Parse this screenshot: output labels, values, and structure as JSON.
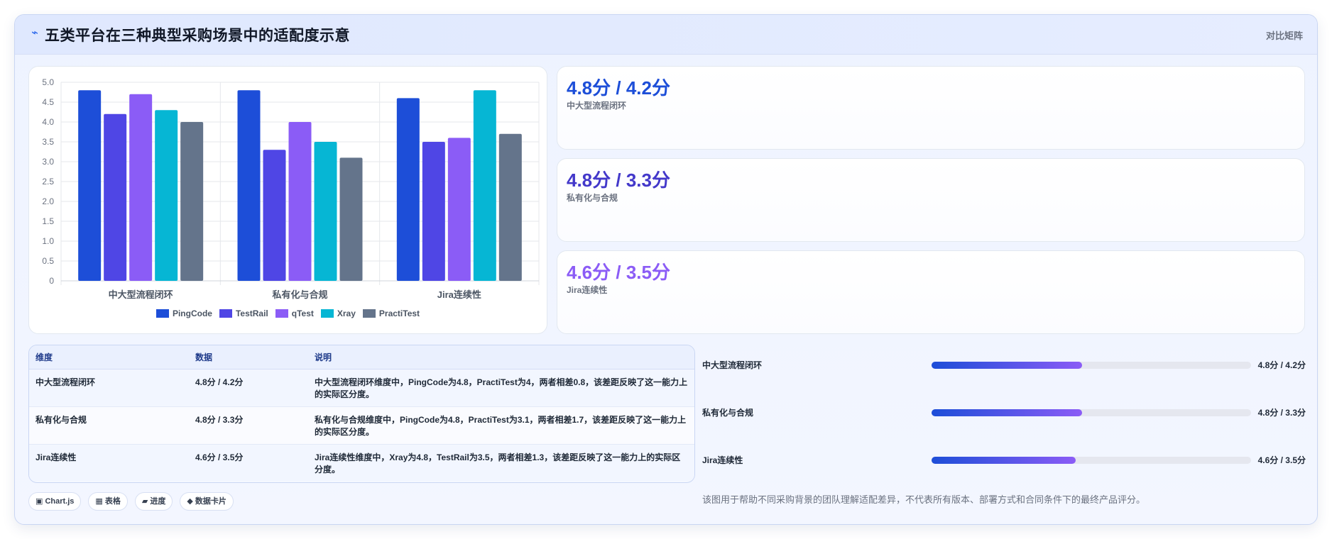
{
  "header": {
    "icon": "trend-icon",
    "title": "五类平台在三种典型采购场景中的适配度示意",
    "right_label": "对比矩阵"
  },
  "chart_data": {
    "type": "bar",
    "categories": [
      "中大型流程闭环",
      "私有化与合规",
      "Jira连续性"
    ],
    "series": [
      {
        "name": "PingCode",
        "color": "#1d4ed8",
        "values": [
          4.8,
          4.8,
          4.6
        ]
      },
      {
        "name": "TestRail",
        "color": "#4f46e5",
        "values": [
          4.2,
          3.3,
          3.5
        ]
      },
      {
        "name": "qTest",
        "color": "#8b5cf6",
        "values": [
          4.7,
          4.0,
          3.6
        ]
      },
      {
        "name": "Xray",
        "color": "#06b6d4",
        "values": [
          4.3,
          3.5,
          4.8
        ]
      },
      {
        "name": "PractiTest",
        "color": "#64748b",
        "values": [
          4.0,
          3.1,
          3.7
        ]
      }
    ],
    "ylim": [
      0,
      5
    ],
    "yticks": [
      "0",
      "0.5",
      "1.0",
      "1.5",
      "2.0",
      "2.5",
      "3.0",
      "3.5",
      "4.0",
      "4.5",
      "5.0"
    ],
    "grid": true,
    "legend": "bottom"
  },
  "stats": [
    {
      "value": "4.8分 / 4.2分",
      "label": "中大型流程闭环",
      "color": "#1d4ed8"
    },
    {
      "value": "4.8分 / 3.3分",
      "label": "私有化与合规",
      "color": "#4338ca"
    },
    {
      "value": "4.6分 / 3.5分",
      "label": "Jira连续性",
      "color": "#8b5cf6"
    }
  ],
  "table": {
    "headers": [
      "维度",
      "数据",
      "说明"
    ],
    "rows": [
      {
        "dimension": "中大型流程闭环",
        "data": "4.8分 / 4.2分",
        "note": "中大型流程闭环维度中，PingCode为4.8，PractiTest为4，两者相差0.8，该差距反映了这一能力上的实际区分度。"
      },
      {
        "dimension": "私有化与合规",
        "data": "4.8分 / 3.3分",
        "note": "私有化与合规维度中，PingCode为4.8，PractiTest为3.1，两者相差1.7，该差距反映了这一能力上的实际区分度。"
      },
      {
        "dimension": "Jira连续性",
        "data": "4.6分 / 3.5分",
        "note": "Jira连续性维度中，Xray为4.8，TestRail为3.5，两者相差1.3，该差距反映了这一能力上的实际区分度。"
      }
    ]
  },
  "chips": [
    "▣ Chart.js",
    "▦ 表格",
    "▰ 进度",
    "◆ 数据卡片"
  ],
  "progress": [
    {
      "label": "中大型流程闭环",
      "value": "4.8分 / 4.2分",
      "fraction": 0.47
    },
    {
      "label": "私有化与合规",
      "value": "4.8分 / 3.3分",
      "fraction": 0.47
    },
    {
      "label": "Jira连续性",
      "value": "4.6分 / 3.5分",
      "fraction": 0.45
    }
  ],
  "footnote": "该图用于帮助不同采购背景的团队理解适配差异，不代表所有版本、部署方式和合同条件下的最终产品评分。"
}
